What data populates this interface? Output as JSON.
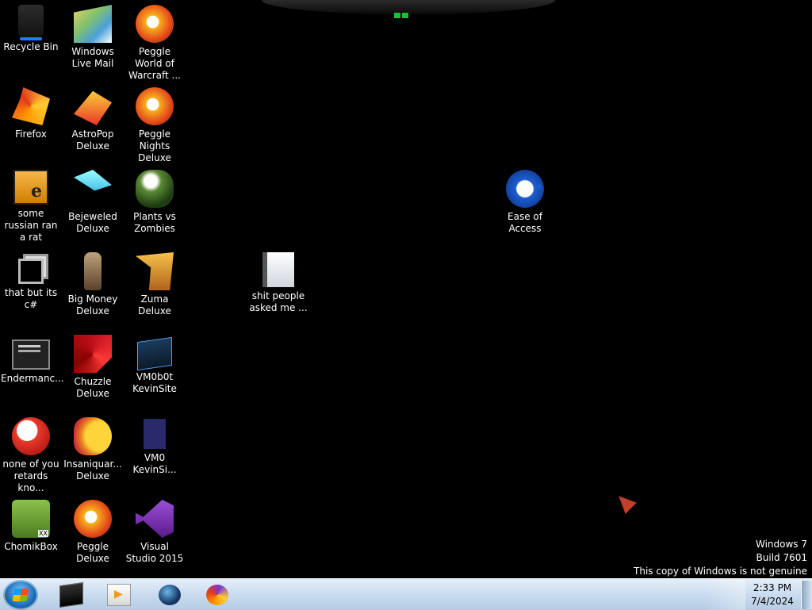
{
  "desktop": {
    "icons": [
      {
        "label": "Recycle Bin",
        "icon": "recycle-bin-icon"
      },
      {
        "label": "Windows Live Mail",
        "icon": "mail-icon"
      },
      {
        "label": "Peggle World of Warcraft ...",
        "icon": "peggle-icon"
      },
      {
        "label": "Firefox",
        "icon": "firefox-icon"
      },
      {
        "label": "AstroPop Deluxe",
        "icon": "astropop-icon"
      },
      {
        "label": "Peggle Nights Deluxe",
        "icon": "peggle-nights-icon"
      },
      {
        "label": "some russian ran a rat",
        "icon": "app-cube-icon"
      },
      {
        "label": "Bejeweled Deluxe",
        "icon": "bejeweled-icon"
      },
      {
        "label": "Plants vs Zombies",
        "icon": "plants-icon"
      },
      {
        "label": "that but its c#",
        "icon": "stacked-windows-icon"
      },
      {
        "label": "Big Money Deluxe",
        "icon": "big-money-icon"
      },
      {
        "label": "Zuma Deluxe",
        "icon": "zuma-icon"
      },
      {
        "label": "shit people asked me ...",
        "icon": "folder-icon"
      },
      {
        "label": "Endermanc...",
        "icon": "console-app-icon"
      },
      {
        "label": "Chuzzle Deluxe",
        "icon": "chuzzle-icon"
      },
      {
        "label": "VM0b0t KevinSite",
        "icon": "vm-icon"
      },
      {
        "label": "none of you retards kno...",
        "icon": "ball-icon"
      },
      {
        "label": "Insaniquar... Deluxe",
        "icon": "fish-icon"
      },
      {
        "label": "VM0 KevinSi...",
        "icon": "vm-dark-icon"
      },
      {
        "label": "ChomikBox",
        "icon": "chomikbox-icon"
      },
      {
        "label": "Peggle Deluxe",
        "icon": "peggle-deluxe-icon"
      },
      {
        "label": "Visual Studio 2015",
        "icon": "visual-studio-icon"
      },
      {
        "label": "Ease of Access",
        "icon": "ease-of-access-icon"
      }
    ]
  },
  "watermark": {
    "line1": "Windows 7",
    "line2": "Build 7601",
    "line3": "This copy of Windows is not genuine"
  },
  "taskbar": {
    "items": [
      {
        "icon": "command-prompt-icon"
      },
      {
        "icon": "media-player-icon"
      },
      {
        "icon": "globe-app-icon"
      },
      {
        "icon": "firefox-icon"
      }
    ],
    "clock": {
      "time": "2:33 PM",
      "date": "7/4/2024"
    }
  },
  "colors": {
    "desktop_background": "#000000",
    "taskbar_background": "#c9dcef",
    "notch_light": "#17c03a"
  }
}
